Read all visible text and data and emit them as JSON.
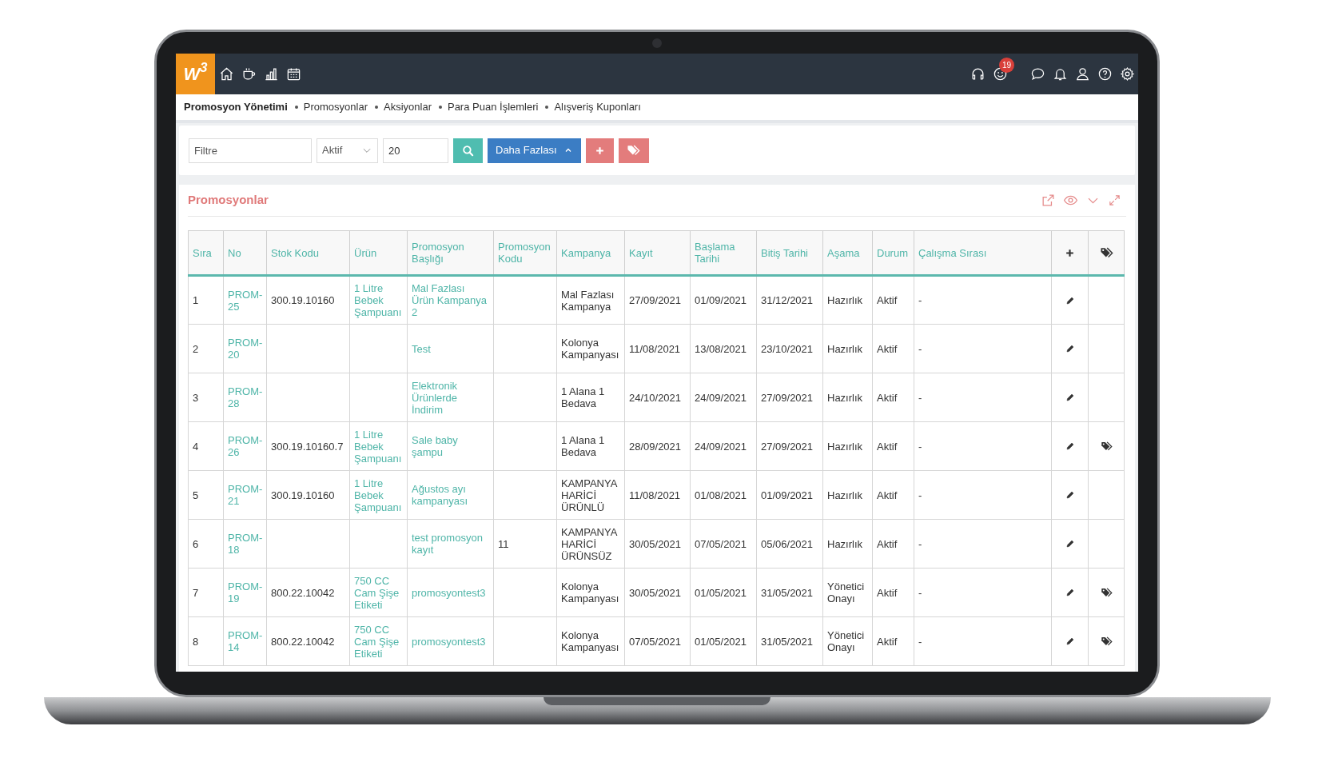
{
  "header": {
    "logo": "W$^{3}$",
    "notification_count": "19"
  },
  "breadcrumb": [
    {
      "label": "Promosyon Yönetimi",
      "current": true
    },
    {
      "label": "Promosyonlar",
      "current": false
    },
    {
      "label": "Aksiyonlar",
      "current": false
    },
    {
      "label": "Para Puan İşlemleri",
      "current": false
    },
    {
      "label": "Alışveriş Kuponları",
      "current": false
    }
  ],
  "filters": {
    "filter_placeholder": "Filtre",
    "status_value": "Aktif",
    "count_value": "20",
    "more_button": "Daha Fazlası"
  },
  "panel": {
    "title": "Promosyonlar"
  },
  "table": {
    "columns": [
      {
        "label": "Sıra",
        "kind": "text"
      },
      {
        "label": "No",
        "kind": "link"
      },
      {
        "label": "Stok Kodu",
        "kind": "text"
      },
      {
        "label": "Ürün",
        "kind": "link"
      },
      {
        "label": "Promosyon Başlığı",
        "kind": "link"
      },
      {
        "label": "Promosyon Kodu",
        "kind": "text"
      },
      {
        "label": "Kampanya",
        "kind": "text"
      },
      {
        "label": "Kayıt",
        "kind": "text"
      },
      {
        "label": "Başlama Tarihi",
        "kind": "text"
      },
      {
        "label": "Bitiş Tarihi",
        "kind": "text"
      },
      {
        "label": "Aşama",
        "kind": "text"
      },
      {
        "label": "Durum",
        "kind": "text"
      },
      {
        "label": "Çalışma Sırası",
        "kind": "text"
      }
    ],
    "rows": [
      {
        "cells": [
          "1",
          "PROM-25",
          "300.19.10160",
          "1 Litre Bebek Şampuanı",
          "Mal Fazlası Ürün Kampanya 2",
          null,
          "Mal Fazlası Kampanya",
          "27/09/2021",
          "01/09/2021",
          "31/12/2021",
          "Hazırlık",
          "Aktif",
          "-"
        ],
        "tagged": false
      },
      {
        "cells": [
          "2",
          "PROM-20",
          null,
          null,
          "Test",
          null,
          "Kolonya Kampanyası",
          "11/08/2021",
          "13/08/2021",
          "23/10/2021",
          "Hazırlık",
          "Aktif",
          "-"
        ],
        "tagged": false
      },
      {
        "cells": [
          "3",
          "PROM-28",
          null,
          null,
          "Elektronik Ürünlerde İndirim",
          null,
          "1 Alana 1 Bedava",
          "24/10/2021",
          "24/09/2021",
          "27/09/2021",
          "Hazırlık",
          "Aktif",
          "-"
        ],
        "tagged": false
      },
      {
        "cells": [
          "4",
          "PROM-26",
          "300.19.10160.7",
          "1 Litre Bebek Şampuanı",
          "Sale baby şampu",
          null,
          "1 Alana 1 Bedava",
          "28/09/2021",
          "24/09/2021",
          "27/09/2021",
          "Hazırlık",
          "Aktif",
          "-"
        ],
        "tagged": true
      },
      {
        "cells": [
          "5",
          "PROM-21",
          "300.19.10160",
          "1 Litre Bebek Şampuanı",
          "Ağustos ayı kampanyası",
          null,
          "KAMPANYA HARİCİ ÜRÜNLÜ",
          "11/08/2021",
          "01/08/2021",
          "01/09/2021",
          "Hazırlık",
          "Aktif",
          "-"
        ],
        "tagged": false
      },
      {
        "cells": [
          "6",
          "PROM-18",
          null,
          null,
          "test promosyon kayıt",
          "11",
          "KAMPANYA HARİCİ ÜRÜNSÜZ",
          "30/05/2021",
          "07/05/2021",
          "05/06/2021",
          "Hazırlık",
          "Aktif",
          "-"
        ],
        "tagged": false
      },
      {
        "cells": [
          "7",
          "PROM-19",
          "800.22.10042",
          "750 CC Cam Şişe Etiketi",
          "promosyontest3",
          null,
          "Kolonya Kampanyası",
          "30/05/2021",
          "01/05/2021",
          "31/05/2021",
          "Yönetici Onayı",
          "Aktif",
          "-"
        ],
        "tagged": true
      },
      {
        "cells": [
          "8",
          "PROM-14",
          "800.22.10042",
          "750 CC Cam Şişe Etiketi",
          "promosyontest3",
          null,
          "Kolonya Kampanyası",
          "07/05/2021",
          "01/05/2021",
          "31/05/2021",
          "Yönetici Onayı",
          "Aktif",
          "-"
        ],
        "tagged": true
      }
    ]
  }
}
